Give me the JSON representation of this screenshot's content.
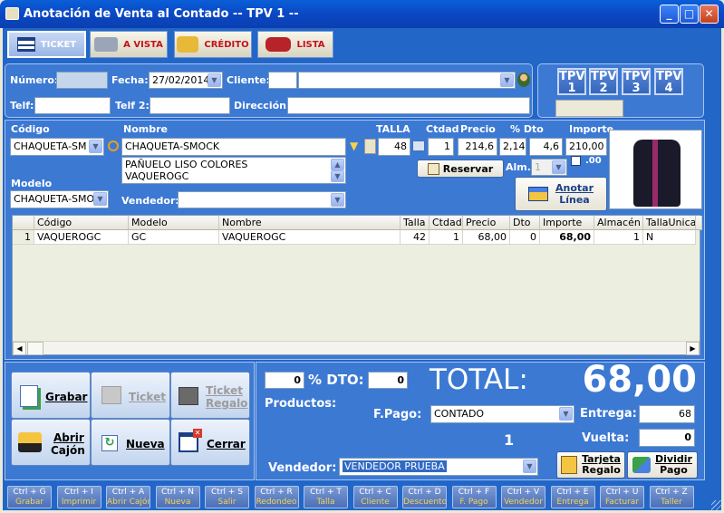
{
  "window": {
    "title": "Anotación de Venta al Contado -- TPV 1 --"
  },
  "toolbar": {
    "ticket": "TICKET",
    "avista": "A VISTA",
    "credito": "CRÉDITO",
    "lista": "LISTA"
  },
  "header": {
    "numero_label": "Número:",
    "numero": "",
    "fecha_label": "Fecha:",
    "fecha": "27/02/2014",
    "cliente_label": "Cliente:",
    "cliente_code": "",
    "cliente_name": "",
    "telf_label": "Telf:",
    "telf": "",
    "telf2_label": "Telf 2:",
    "telf2": "",
    "direccion_label": "Dirección:",
    "direccion": ""
  },
  "tpv": [
    "TPV 1",
    "TPV 2",
    "TPV 3",
    "TPV 4"
  ],
  "line": {
    "codigo_label": "Código",
    "codigo": "CHAQUETA-SM",
    "nombre_label": "Nombre",
    "nombre": "CHAQUETA-SMOCK",
    "talla_label": "TALLA",
    "talla": "48",
    "ctdad_label": "Ctdad",
    "ctdad": "1",
    "precio_label": "Precio",
    "precio": "214,6",
    "dto_label": "% Dto",
    "dto": "2,14",
    "dto2": "4,6",
    "importe_label": "Importe",
    "importe": "210,00",
    "desc_lines": [
      "PAÑUELO LISO COLORES",
      "VAQUEROGC"
    ],
    "reservar": "Reservar",
    "alm_label": "Alm.:",
    "alm": "1",
    "decimals": ".00",
    "modelo_label": "Modelo",
    "modelo": "CHAQUETA-SMO",
    "vendedor_label": "Vendedor:",
    "vendedor": "",
    "anotar": [
      "Anotar",
      "Línea"
    ]
  },
  "grid": {
    "headers": [
      "",
      "Código",
      "Modelo",
      "Nombre",
      "Talla",
      "Ctdad.",
      "Precio",
      "Dto",
      "Importe",
      "Almacén",
      "TallaUnica"
    ],
    "rows": [
      [
        "1",
        "VAQUEROGC",
        "GC",
        "VAQUEROGC",
        "42",
        "1",
        "68,00",
        "0",
        "68,00",
        "1",
        "N"
      ]
    ]
  },
  "actions": {
    "grabar": "Grabar",
    "ticket": "Ticket",
    "ticket_regalo": [
      "Ticket",
      "Regalo"
    ],
    "abrir_cajon": [
      "Abrir",
      "Cajón"
    ],
    "nueva": "Nueva",
    "cerrar": "Cerrar"
  },
  "totals": {
    "dto_value": "0",
    "dto_label": "% DTO:",
    "dto_amount": "0",
    "total_label": "TOTAL:",
    "total": "68,00",
    "productos_label": "Productos:",
    "productos": "1",
    "fpago_label": "F.Pago:",
    "fpago": "CONTADO",
    "entrega_label": "Entrega:",
    "entrega": "68",
    "vuelta_label": "Vuelta:",
    "vuelta": "0",
    "vendedor_label": "Vendedor:",
    "vendedor": "VENDEDOR PRUEBA",
    "tarjeta": [
      "Tarjeta",
      "Regalo"
    ],
    "dividir": [
      "Dividir",
      "Pago"
    ]
  },
  "shortcuts": [
    [
      "Ctrl + G",
      "Grabar"
    ],
    [
      "Ctrl + I",
      "Imprimir"
    ],
    [
      "Ctrl + A",
      "Abrir Cajón"
    ],
    [
      "Ctrl + N",
      "Nueva"
    ],
    [
      "Ctrl + S",
      "Salir"
    ],
    [
      "Ctrl + R",
      "Redondeo"
    ],
    [
      "Ctrl + T",
      "Talla"
    ],
    [
      "Ctrl + C",
      "Cliente"
    ],
    [
      "Ctrl + D",
      "Descuento"
    ],
    [
      "Ctrl + F",
      "F. Pago"
    ],
    [
      "Ctrl + V",
      "Vendedor"
    ],
    [
      "Ctrl + E",
      "Entrega"
    ],
    [
      "Ctrl + U",
      "Facturar"
    ],
    [
      "Ctrl + Z",
      "Taller"
    ]
  ]
}
